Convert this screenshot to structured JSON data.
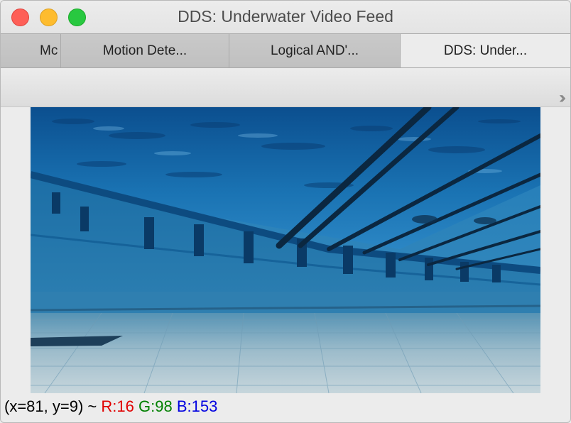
{
  "window": {
    "title": "DDS: Underwater Video Feed"
  },
  "tabs": [
    {
      "label": "Mc",
      "active": false
    },
    {
      "label": "Motion Dete...",
      "active": false
    },
    {
      "label": "Logical AND'...",
      "active": false
    },
    {
      "label": "DDS: Under...",
      "active": true
    }
  ],
  "toolbar": {
    "overflow_icon": "double-chevron-right-icon",
    "overflow_glyph": "››"
  },
  "video": {
    "description_icon": "video-frame"
  },
  "status": {
    "coords": "(x=81, y=9) ~",
    "r": "R:16",
    "g": "G:98",
    "b": "B:153"
  },
  "colors": {
    "close": "#fe5f57",
    "minimize": "#febc2e",
    "maximize": "#28c840",
    "r_text": "#e00000",
    "g_text": "#008000",
    "b_text": "#0000e0"
  }
}
